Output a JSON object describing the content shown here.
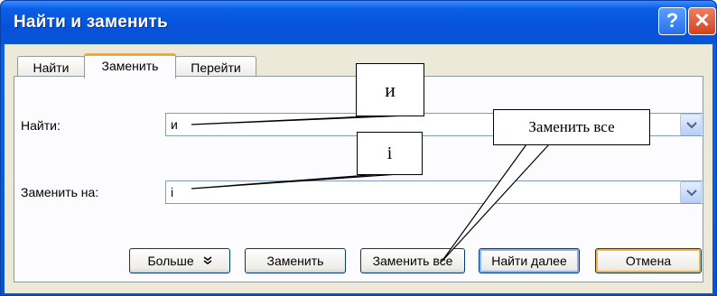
{
  "window": {
    "title": "Найти и заменить",
    "help_label": "?",
    "close_label": "✕"
  },
  "tabs": [
    {
      "label": "Найти",
      "active": false
    },
    {
      "label": "Заменить",
      "active": true
    },
    {
      "label": "Перейти",
      "active": false
    }
  ],
  "find": {
    "label": "Найти:",
    "value": "и"
  },
  "replace": {
    "label": "Заменить на:",
    "value": "і"
  },
  "buttons": {
    "more": "Больше",
    "more_icon": "double-chevron-down-icon",
    "replace": "Заменить",
    "replace_all": "Заменить все",
    "find_next": "Найти далее",
    "cancel": "Отмена"
  },
  "callouts": {
    "find_char": "и",
    "replace_char": "і",
    "replace_all": "Заменить все"
  },
  "colors": {
    "title_bar": "#0a5fe6",
    "dialog_bg": "#ece9d8",
    "active_tab_accent": "#f5a827",
    "close_button": "#d4401e"
  }
}
